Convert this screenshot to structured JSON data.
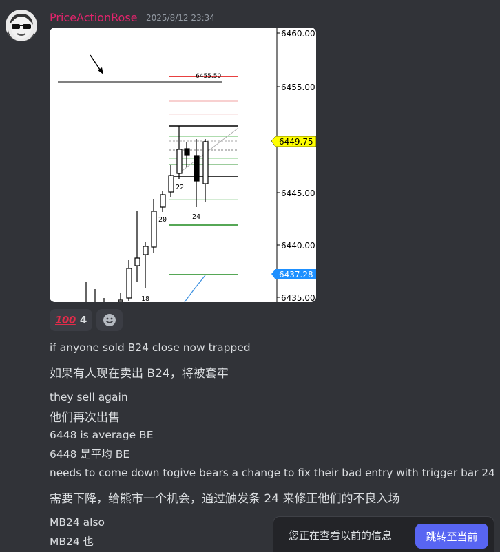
{
  "message": {
    "username": "PriceActionRose",
    "timestamp": "2025/8/12 23:34",
    "username_color": "#e0246b"
  },
  "chart_data": {
    "type": "candlestick",
    "price_ticks": [
      "6460.00",
      "6455.00",
      "6445.00",
      "6440.00",
      "6435.00"
    ],
    "price_tags": [
      {
        "label": "6449.75",
        "color": "#ffff00"
      },
      {
        "label": "6437.28",
        "color": "#1e90ff"
      }
    ],
    "level_label": "6455.50",
    "bar_labels": [
      "22",
      "20",
      "24",
      "18"
    ]
  },
  "reactions": [
    {
      "emoji": "100",
      "emoji_name": "hundred-points",
      "count": "4"
    }
  ],
  "messages": [
    {
      "text": "if anyone sold B24 close now trapped"
    },
    {
      "text": "如果有人现在卖出 B24，将被套牢"
    },
    {
      "text": "they sell again"
    },
    {
      "text": "他们再次出售"
    },
    {
      "text": "6448 is average BE"
    },
    {
      "text": "6448 是平均 BE"
    },
    {
      "text": "needs to come down togive bears a change to fix their bad entry with trigger bar 24"
    },
    {
      "text": "需要下降，给熊市一个机会，通过触发条 24 来修正他们的不良入场"
    },
    {
      "text": "MB24 also"
    },
    {
      "text": "MB24 也"
    }
  ],
  "jumpbar": {
    "text": "您正在查看以前的信息",
    "button": "跳转至当前"
  }
}
